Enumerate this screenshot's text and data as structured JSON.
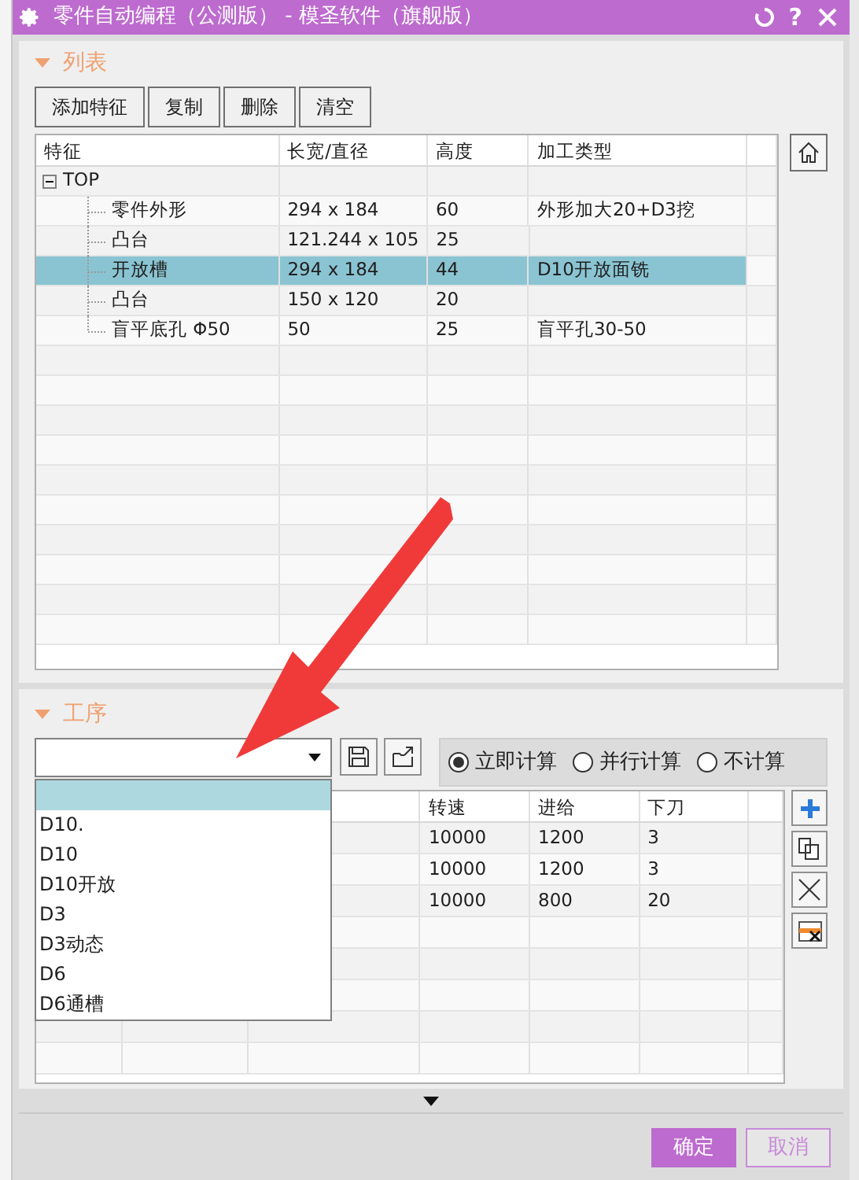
{
  "window": {
    "title": "零件自动编程（公测版） - 模圣软件（旗舰版）",
    "help": "?"
  },
  "list_section": {
    "title": "列表",
    "expanded": true,
    "buttons": [
      "添加特征",
      "复制",
      "删除",
      "清空"
    ],
    "table": {
      "columns": [
        "特征",
        "长宽/直径",
        "高度",
        "加工类型"
      ],
      "tree": [
        {
          "cells": [
            "TOP",
            "",
            "",
            ""
          ],
          "expanded": true,
          "selected": false,
          "children": [
            {
              "cells": [
                "零件外形",
                "294 x 184",
                "60",
                "外形加大20+D3挖"
              ],
              "selected": false
            },
            {
              "cells": [
                "凸台",
                "121.244 x 105",
                "25",
                ""
              ],
              "selected": false
            },
            {
              "cells": [
                "开放槽",
                "294 x 184",
                "44",
                "D10开放面铣"
              ],
              "selected": true
            },
            {
              "cells": [
                "凸台",
                "150 x 120",
                "20",
                ""
              ],
              "selected": false
            },
            {
              "cells": [
                "盲平底孔 Φ50",
                "50",
                "25",
                "盲平孔30-50"
              ],
              "selected": false
            }
          ]
        }
      ]
    }
  },
  "process_section": {
    "title": "工序",
    "expanded": true,
    "radios": [
      {
        "label": "立即计算",
        "selected": true
      },
      {
        "label": "并行计算",
        "selected": false
      },
      {
        "label": "不计算",
        "selected": false
      }
    ],
    "table": {
      "columns": [
        "转速",
        "进给",
        "下刀"
      ],
      "rows": [
        [
          "10000",
          "1200",
          "3"
        ],
        [
          "10000",
          "1200",
          "3"
        ],
        [
          "10000",
          "800",
          "20"
        ]
      ]
    },
    "dropdown": {
      "open": true,
      "items": [
        {
          "selected": true
        },
        {
          "label": "D10.",
          "selected": false
        },
        {
          "label": "D10",
          "selected": false
        },
        {
          "label": "D10开放",
          "selected": false
        },
        {
          "label": "D3",
          "selected": false
        },
        {
          "label": "D3动态",
          "selected": false
        },
        {
          "label": "D6",
          "selected": false
        },
        {
          "label": "D6通槽",
          "selected": false
        }
      ]
    }
  },
  "footer": {
    "buttons": [
      {
        "label": "确定",
        "kind": "primary"
      },
      {
        "label": "取消",
        "kind": "secondary"
      }
    ]
  }
}
